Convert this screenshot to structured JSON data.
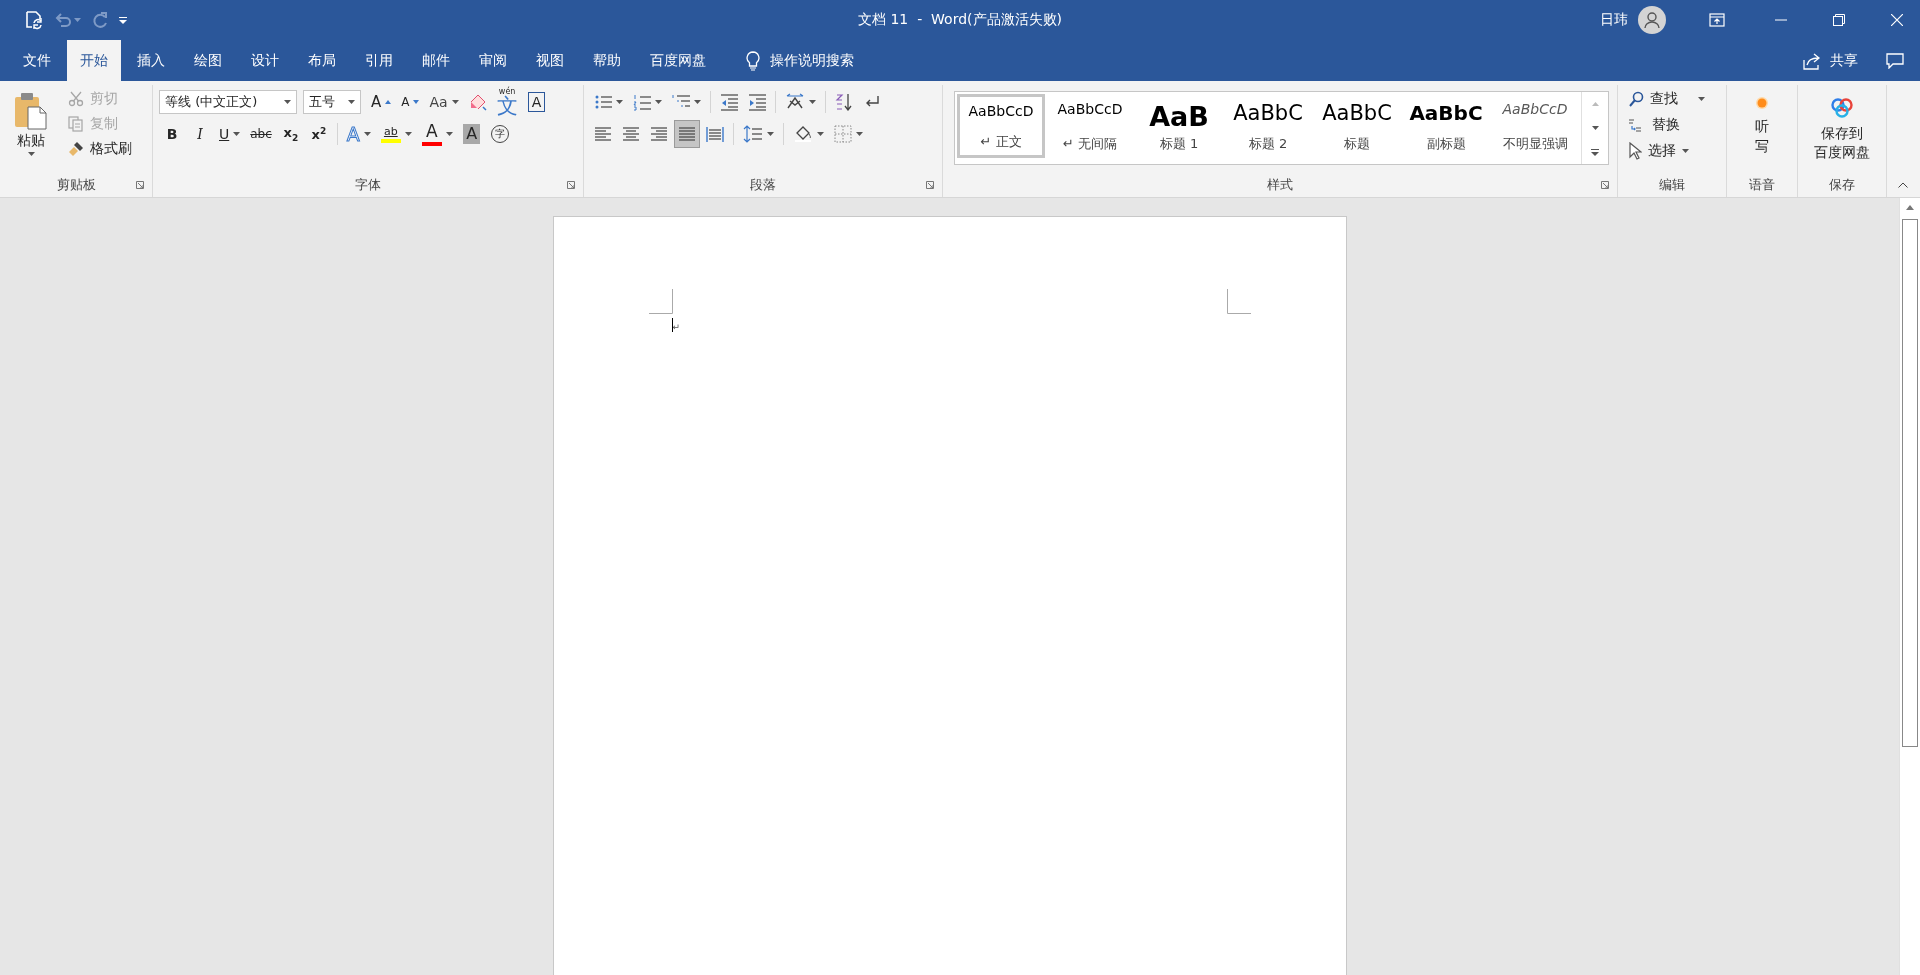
{
  "title_bar": {
    "title": "文档 11  -  Word(产品激活失败)",
    "user_name": "日玮"
  },
  "tabs": [
    {
      "label": "文件",
      "selected": false
    },
    {
      "label": "开始",
      "selected": true
    },
    {
      "label": "插入",
      "selected": false
    },
    {
      "label": "绘图",
      "selected": false
    },
    {
      "label": "设计",
      "selected": false
    },
    {
      "label": "布局",
      "selected": false
    },
    {
      "label": "引用",
      "selected": false
    },
    {
      "label": "邮件",
      "selected": false
    },
    {
      "label": "审阅",
      "selected": false
    },
    {
      "label": "视图",
      "selected": false
    },
    {
      "label": "帮助",
      "selected": false
    },
    {
      "label": "百度网盘",
      "selected": false
    }
  ],
  "tell_me": {
    "label": "操作说明搜索"
  },
  "share": {
    "label": "共享"
  },
  "ribbon": {
    "clipboard": {
      "label": "剪贴板",
      "paste": "粘贴",
      "items": [
        {
          "kind": "cut",
          "label": "剪切",
          "disabled": true
        },
        {
          "kind": "copy",
          "label": "复制",
          "disabled": true
        },
        {
          "kind": "painter",
          "label": "格式刷",
          "disabled": false
        }
      ]
    },
    "font": {
      "label": "字体",
      "font_name": "等线 (中文正文)",
      "font_size": "五号",
      "row1": [
        {
          "kind": "grow",
          "text": "A"
        },
        {
          "kind": "shrink",
          "text": "A"
        },
        {
          "kind": "case",
          "text": "Aa"
        },
        {
          "kind": "clear"
        },
        {
          "kind": "phonetic",
          "ruby": "wén",
          "text": "文"
        },
        {
          "kind": "border",
          "text": "A"
        }
      ],
      "row2": [
        {
          "kind": "bold",
          "text": "B"
        },
        {
          "kind": "italic",
          "text": "I"
        },
        {
          "kind": "underline",
          "text": "U"
        },
        {
          "kind": "strike",
          "text": "abc"
        },
        {
          "kind": "subscript",
          "text": "x$_{2}$"
        },
        {
          "kind": "superscript",
          "text": "x$^{2}$"
        },
        {
          "kind": "effects",
          "text": "A"
        },
        {
          "kind": "highlight",
          "text": "ab",
          "color": "#ffff00"
        },
        {
          "kind": "font_color",
          "text": "A",
          "color": "#ff0000"
        },
        {
          "kind": "shading",
          "text": "A"
        },
        {
          "kind": "enclose",
          "text": "字"
        }
      ]
    },
    "paragraph": {
      "label": "段落",
      "alignments": [
        {
          "kind": "left",
          "selected": false
        },
        {
          "kind": "center",
          "selected": false
        },
        {
          "kind": "right",
          "selected": false
        },
        {
          "kind": "justify",
          "selected": true
        },
        {
          "kind": "distributed",
          "selected": false
        }
      ]
    },
    "styles": {
      "label": "样式",
      "items": [
        {
          "kind": "normal",
          "preview": "AaBbCcD",
          "label": "↵ 正文",
          "selected": true
        },
        {
          "kind": "no_spacing",
          "preview": "AaBbCcD",
          "label": "↵ 无间隔",
          "selected": false
        },
        {
          "kind": "heading1",
          "preview": "AaB",
          "label": "标题 1",
          "selected": false
        },
        {
          "kind": "heading2",
          "preview": "AaBbC",
          "label": "标题 2",
          "selected": false
        },
        {
          "kind": "title",
          "preview": "AaBbC",
          "label": "标题",
          "selected": false
        },
        {
          "kind": "subtitle",
          "preview": "AaBbC",
          "label": "副标题",
          "selected": false
        },
        {
          "kind": "subtle",
          "preview": "AaBbCcD",
          "label": "不明显强调",
          "selected": false
        }
      ]
    },
    "editing": {
      "label": "编辑",
      "find": "查找",
      "replace": "替换",
      "select": "选择"
    },
    "voice": {
      "label": "语音",
      "dictate": "听写"
    },
    "save": {
      "label": "保存",
      "button_lines": [
        "保存到",
        "百度网盘"
      ]
    }
  },
  "document": {
    "paragraph_mark": "↵"
  }
}
